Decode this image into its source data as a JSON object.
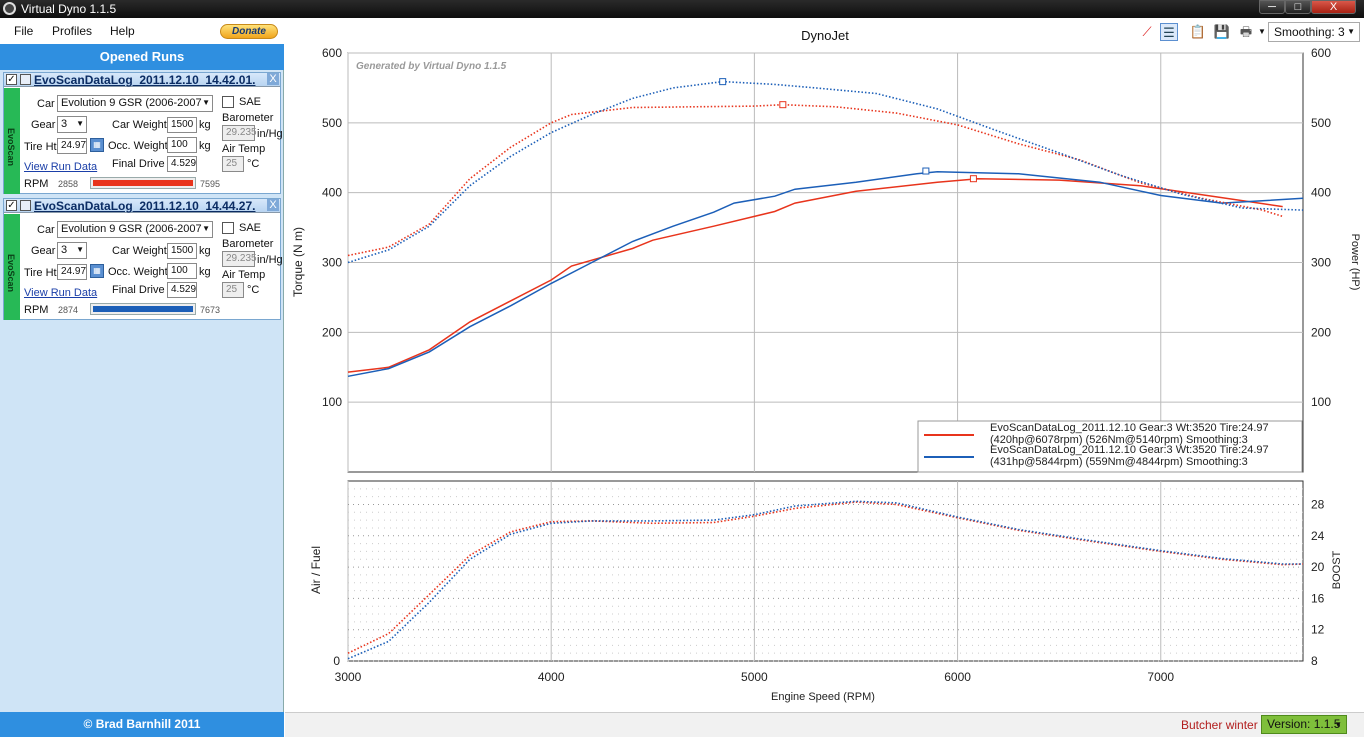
{
  "window": {
    "title": "Virtual Dyno 1.1.5",
    "minimize": "─",
    "maximize": "□",
    "close": "X"
  },
  "menu": {
    "file": "File",
    "profiles": "Profiles",
    "help": "Help",
    "donate": "Donate"
  },
  "panel": {
    "header": "Opened Runs",
    "copyright": "© Brad Barnhill 2011"
  },
  "labels": {
    "car": "Car",
    "sae": "SAE",
    "gear": "Gear",
    "car_weight": "Car Weight",
    "kg": "kg",
    "barometer": "Barometer",
    "inhg": "in/Hg",
    "tire_ht": "Tire Ht",
    "occ_weight": "Occ. Weight",
    "air_temp": "Air Temp",
    "deg_c": "°C",
    "view_run_data": "View Run Data",
    "final_drive": "Final Drive",
    "rpm": "RPM",
    "side_tab": "EvoScan"
  },
  "runs": [
    {
      "title": "EvoScanDataLog_2011.12.10_14.42.01.",
      "car": "Evolution 9 GSR (2006-2007",
      "gear": "3",
      "car_weight": "1500",
      "occ_weight": "100",
      "tire_ht": "24.97",
      "barometer": "29.235",
      "air_temp": "25",
      "final_drive": "4.529",
      "rpm_min": "2858",
      "rpm_max": "7595",
      "color": "#e8341c"
    },
    {
      "title": "EvoScanDataLog_2011.12.10_14.44.27.",
      "car": "Evolution 9 GSR (2006-2007",
      "gear": "3",
      "car_weight": "1500",
      "occ_weight": "100",
      "tire_ht": "24.97",
      "barometer": "29.235",
      "air_temp": "25",
      "final_drive": "4.529",
      "rpm_min": "2874",
      "rpm_max": "7673",
      "color": "#1c5fb8"
    }
  ],
  "toolbar": {
    "smoothing": "Smoothing: 3"
  },
  "status": {
    "text": "Butcher winter",
    "version": "Version: 1.1.5"
  },
  "chart_data": [
    {
      "type": "line",
      "title": "DynoJet",
      "watermark": "Generated by Virtual Dyno 1.1.5",
      "xlabel": "Engine Speed (RPM)",
      "ylabel": "Torque (N m)",
      "y2label": "Power (HP)",
      "xlim": [
        3000,
        7700
      ],
      "ylim": [
        0,
        600
      ],
      "xticks": [
        3000,
        4000,
        5000,
        6000,
        7000
      ],
      "yticks": [
        100,
        200,
        300,
        400,
        500,
        600
      ],
      "grid": true,
      "legend_position": "bottom-right",
      "legend": [
        {
          "line1": "EvoScanDataLog_2011.12.10 Gear:3 Wt:3520 Tire:24.97",
          "line2": "(420hp@6078rpm) (526Nm@5140rpm) Smoothing:3",
          "color": "#e8341c"
        },
        {
          "line1": "EvoScanDataLog_2011.12.10 Gear:3 Wt:3520 Tire:24.97",
          "line2": "(431hp@5844rpm) (559Nm@4844rpm) Smoothing:3",
          "color": "#1c5fb8"
        }
      ],
      "series": [
        {
          "name": "EvoScanDataLog_2011.12.10 Power",
          "color": "#e8341c",
          "style": "solid",
          "axis": "right",
          "x": [
            3000,
            3200,
            3400,
            3600,
            3800,
            4000,
            4100,
            4400,
            4500,
            4800,
            5100,
            5200,
            5500,
            5900,
            6100,
            6500,
            6900,
            7300,
            7600
          ],
          "y": [
            143,
            150,
            175,
            215,
            245,
            275,
            295,
            320,
            332,
            352,
            373,
            385,
            402,
            415,
            420,
            418,
            410,
            393,
            380
          ]
        },
        {
          "name": "EvoScanDataLog_2011.12.10 Power",
          "color": "#1c5fb8",
          "style": "solid",
          "axis": "right",
          "x": [
            3000,
            3200,
            3400,
            3600,
            3800,
            4000,
            4200,
            4400,
            4600,
            4800,
            4900,
            5100,
            5200,
            5500,
            5800,
            5900,
            6300,
            6700,
            7000,
            7300,
            7700
          ],
          "y": [
            137,
            148,
            172,
            208,
            238,
            270,
            300,
            330,
            352,
            372,
            385,
            395,
            405,
            415,
            427,
            430,
            427,
            415,
            396,
            385,
            392
          ]
        },
        {
          "name": "EvoScanDataLog_2011.12.10 Torque",
          "color": "#e8341c",
          "style": "dotted",
          "axis": "left",
          "x": [
            3000,
            3200,
            3400,
            3600,
            3800,
            4000,
            4100,
            4400,
            4700,
            5000,
            5140,
            5400,
            5700,
            6000,
            6300,
            6600,
            6900,
            7200,
            7500,
            7600
          ],
          "y": [
            310,
            322,
            355,
            420,
            465,
            500,
            512,
            522,
            523,
            524,
            526,
            523,
            514,
            497,
            470,
            447,
            414,
            392,
            375,
            366
          ]
        },
        {
          "name": "EvoScanDataLog_2011.12.10 Torque",
          "color": "#1c5fb8",
          "style": "dotted",
          "axis": "left",
          "x": [
            3000,
            3200,
            3400,
            3600,
            3800,
            4000,
            4200,
            4400,
            4600,
            4844,
            5100,
            5300,
            5600,
            5900,
            6200,
            6500,
            6800,
            7100,
            7400,
            7700
          ],
          "y": [
            300,
            318,
            352,
            410,
            452,
            486,
            512,
            535,
            550,
            559,
            555,
            550,
            542,
            520,
            488,
            457,
            425,
            398,
            378,
            375
          ]
        }
      ],
      "markers": [
        {
          "x": 5140,
          "y": 526,
          "color": "#e8341c",
          "axis": "left"
        },
        {
          "x": 4844,
          "y": 559,
          "color": "#1c5fb8",
          "axis": "left"
        },
        {
          "x": 6078,
          "y": 420,
          "color": "#e8341c",
          "axis": "right"
        },
        {
          "x": 5844,
          "y": 431,
          "color": "#1c5fb8",
          "axis": "right"
        }
      ]
    },
    {
      "type": "line",
      "ylabel": "Air / Fuel",
      "y2label": "BOOST",
      "xlim": [
        3000,
        7700
      ],
      "ylim": [
        8,
        31
      ],
      "yticks_left": [
        0
      ],
      "yticks_right": [
        8,
        12,
        16,
        20,
        24,
        28
      ],
      "grid": true,
      "series": [
        {
          "name": "EvoScanDataLog_2011.12.10 Boost",
          "color": "#e8341c",
          "style": "dotted",
          "x": [
            3000,
            3200,
            3400,
            3600,
            3800,
            4000,
            4200,
            4500,
            4800,
            5000,
            5200,
            5500,
            5700,
            6000,
            6300,
            6600,
            7000,
            7300,
            7600,
            7700
          ],
          "y": [
            9,
            11.5,
            16.5,
            21.5,
            24.5,
            25.8,
            25.9,
            25.6,
            25.7,
            26.5,
            27.5,
            28.3,
            28,
            26.3,
            24.7,
            23.5,
            22,
            21,
            20.3,
            20.4
          ]
        },
        {
          "name": "EvoScanDataLog_2011.12.10 Boost",
          "color": "#1c5fb8",
          "style": "dotted",
          "x": [
            3000,
            3200,
            3400,
            3600,
            3800,
            4000,
            4200,
            4500,
            4800,
            5000,
            5200,
            5500,
            5700,
            6000,
            6300,
            6600,
            7000,
            7300,
            7600,
            7700
          ],
          "y": [
            8.3,
            10.5,
            15.5,
            21,
            24.2,
            25.6,
            25.9,
            25.9,
            26,
            26.7,
            27.8,
            28.4,
            28.2,
            26.4,
            24.8,
            23.6,
            22.1,
            21.1,
            20.4,
            20.4
          ]
        }
      ]
    }
  ]
}
